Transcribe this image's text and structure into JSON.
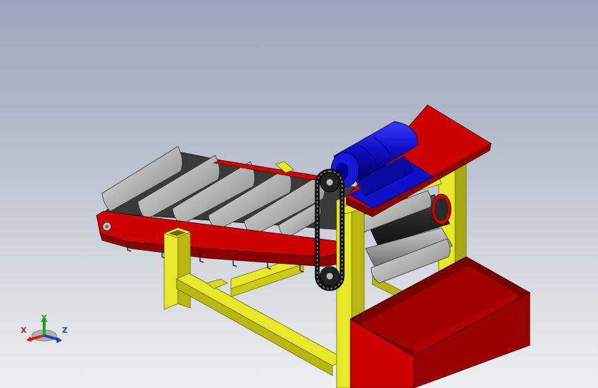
{
  "viewport": {
    "background": "#a9b3c6",
    "model": "inclined-cleated-belt-conveyor-with-motor-and-hopper"
  },
  "colors": {
    "frame_yellow": "#e8e82a",
    "frame_yellow_dark": "#a8a810",
    "conveyor_red": "#cc0000",
    "conveyor_red_dark": "#7a0000",
    "belt_dark": "#3a3a3a",
    "cleat_grey": "#b8b8b8",
    "motor_blue": "#1010c8",
    "motor_blue_dark": "#000070",
    "chain_black": "#1a1a1a"
  },
  "triad": {
    "x_label": "X",
    "y_label": "Y",
    "z_label": "Z",
    "x_color": "#cc2020",
    "y_color": "#20a020",
    "z_color": "#2040cc"
  }
}
